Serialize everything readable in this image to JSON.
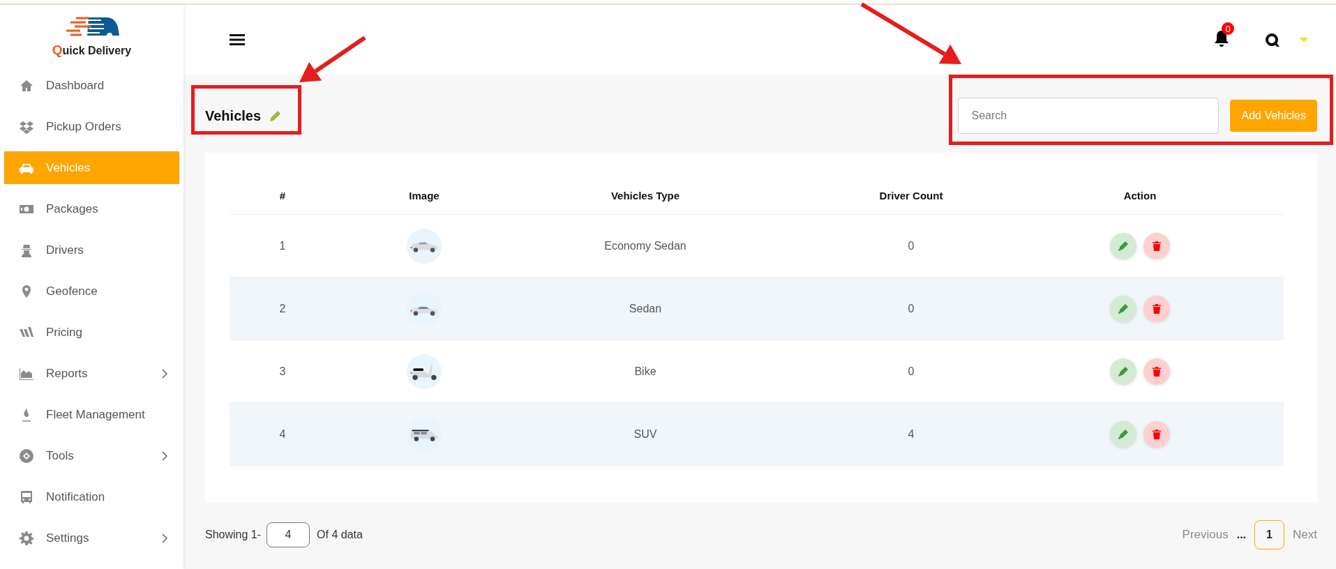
{
  "sidebar": {
    "logo_text": "Quick Delivery",
    "items": [
      {
        "label": "Dashboard",
        "selected": false,
        "has_submenu": false
      },
      {
        "label": "Pickup Orders",
        "selected": false,
        "has_submenu": false
      },
      {
        "label": "Vehicles",
        "selected": true,
        "has_submenu": false
      },
      {
        "label": "Packages",
        "selected": false,
        "has_submenu": false
      },
      {
        "label": "Drivers",
        "selected": false,
        "has_submenu": false
      },
      {
        "label": "Geofence",
        "selected": false,
        "has_submenu": false
      },
      {
        "label": "Pricing",
        "selected": false,
        "has_submenu": false
      },
      {
        "label": "Reports",
        "selected": false,
        "has_submenu": true
      },
      {
        "label": "Fleet Management",
        "selected": false,
        "has_submenu": false
      },
      {
        "label": "Tools",
        "selected": false,
        "has_submenu": true
      },
      {
        "label": "Notification",
        "selected": false,
        "has_submenu": false
      },
      {
        "label": "Settings",
        "selected": false,
        "has_submenu": true
      }
    ]
  },
  "topbar": {
    "notification_count": "0"
  },
  "page": {
    "title": "Vehicles",
    "search": {
      "placeholder": "Search"
    },
    "add_button": "Add Vehicles"
  },
  "table": {
    "columns": [
      "#",
      "Image",
      "Vehicles Type",
      "Driver Count",
      "Action"
    ],
    "rows": [
      {
        "number": "1",
        "kind": "sedan",
        "type": "Economy Sedan",
        "driver_count": "0"
      },
      {
        "number": "2",
        "kind": "coupe",
        "type": "Sedan",
        "driver_count": "0"
      },
      {
        "number": "3",
        "kind": "scooter",
        "type": "Bike",
        "driver_count": "0"
      },
      {
        "number": "4",
        "kind": "suv",
        "type": "SUV",
        "driver_count": "4"
      }
    ]
  },
  "footer": {
    "showing_prefix": "Showing 1-",
    "page_size": "4",
    "showing_suffix": "Of 4 data",
    "pagination": [
      {
        "label": "Previous",
        "kind": "link"
      },
      {
        "label": "...",
        "kind": "ellipsis"
      },
      {
        "label": "1",
        "kind": "page",
        "selected": true
      },
      {
        "label": "Next",
        "kind": "link"
      }
    ]
  },
  "annotations": [
    {
      "kind": "arrow"
    },
    {
      "kind": "frame"
    },
    {
      "kind": "arrow"
    },
    {
      "kind": "frame"
    }
  ]
}
